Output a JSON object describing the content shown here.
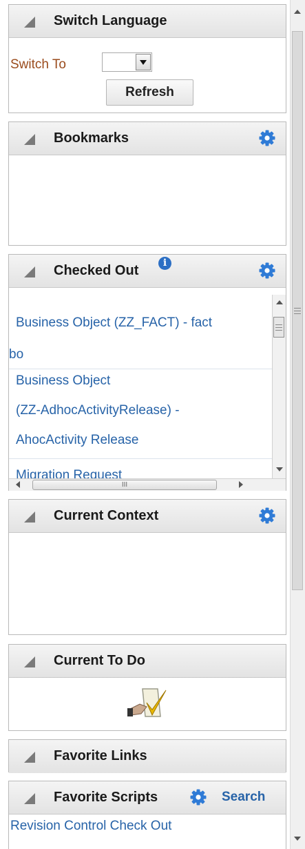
{
  "switch_language": {
    "title": "Switch Language",
    "switch_to_label": "Switch To",
    "language_value": "",
    "refresh_label": "Refresh"
  },
  "bookmarks": {
    "title": "Bookmarks"
  },
  "checked_out": {
    "title": "Checked Out",
    "info_icon_text": "i",
    "items": [
      {
        "line1": "Business Object (ZZ_FACT) - fact",
        "line2": "bo"
      },
      {
        "line1": "Business Object",
        "line2": "(ZZ-AdhocActivityRelease) -",
        "line3": "AhocActivity Release"
      },
      {
        "line1": "Migration Request"
      }
    ],
    "hscroll_grip": "III"
  },
  "current_context": {
    "title": "Current Context"
  },
  "current_to_do": {
    "title": "Current To Do"
  },
  "favorite_links": {
    "title": "Favorite Links"
  },
  "favorite_scripts": {
    "title": "Favorite Scripts",
    "search_label": "Search",
    "items": [
      "Revision Control Check Out"
    ]
  },
  "icons": {
    "collapse": "collapse-triangle-icon",
    "gear": "gear-icon",
    "info": "info-icon",
    "todo": "todo-checkmark-icon"
  },
  "colors": {
    "link": "#2763a8",
    "label": "#9a4b1c",
    "gear": "#2f7bd6",
    "header_bg": "#e8e8e8",
    "border": "#b9b9b9"
  }
}
